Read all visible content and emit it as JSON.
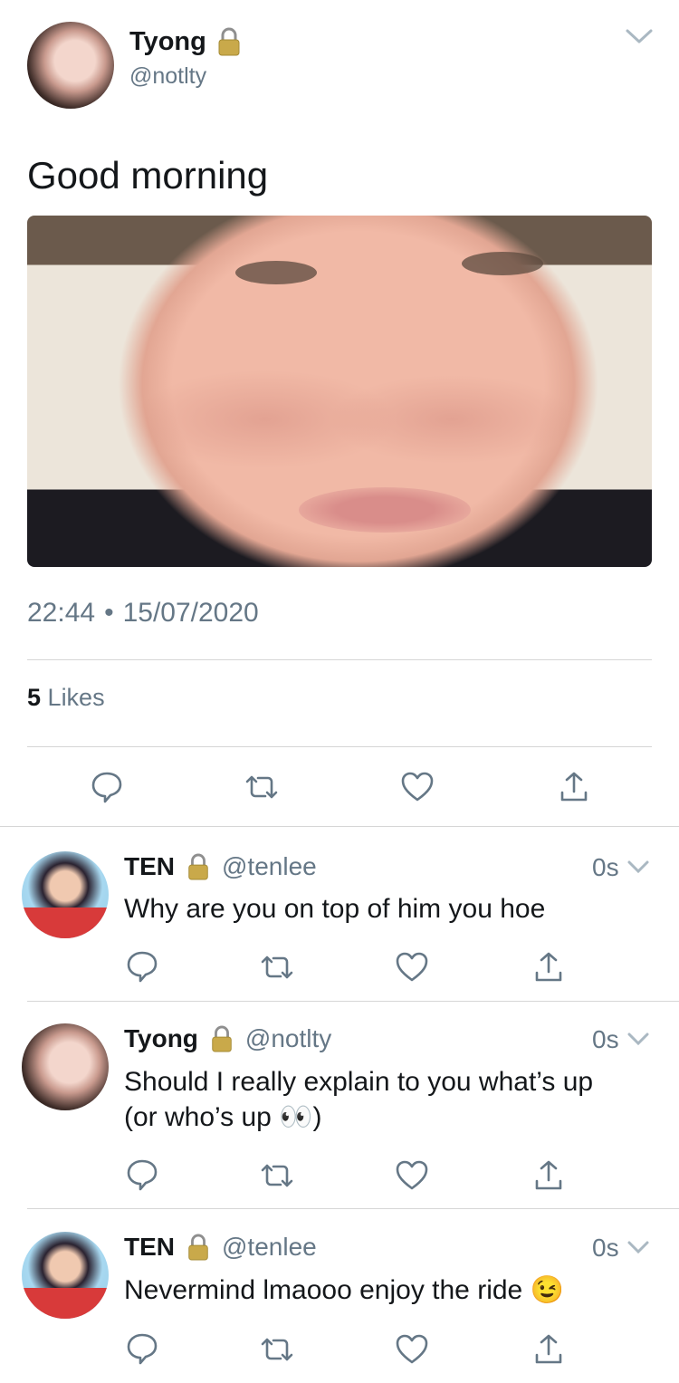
{
  "main_tweet": {
    "name": "Tyong",
    "handle": "@notlty",
    "text": "Good morning",
    "time": "22:44",
    "separator": "•",
    "date": "15/07/2020",
    "likes_count": "5",
    "likes_label": "Likes",
    "more_icon": "chevron-down-icon"
  },
  "replies": [
    {
      "name": "TEN",
      "handle": "@tenlee",
      "time": "0s",
      "text": "Why are you on top of him you hoe"
    },
    {
      "name": "Tyong",
      "handle": "@notlty",
      "time": "0s",
      "text_line1": "Should I really explain to you what’s up",
      "text_line2": "(or who’s up 👀)"
    },
    {
      "name": "TEN",
      "handle": "@tenlee",
      "time": "0s",
      "text": "Nevermind lmaooo enjoy the ride 😉"
    }
  ],
  "colors": {
    "text": "#14171a",
    "secondary": "#657786",
    "divider": "#d6d6d6",
    "lock": "#c9a94a"
  },
  "icons": [
    "reply-icon",
    "retweet-icon",
    "like-icon",
    "share-icon",
    "lock-icon",
    "chevron-down-icon"
  ]
}
